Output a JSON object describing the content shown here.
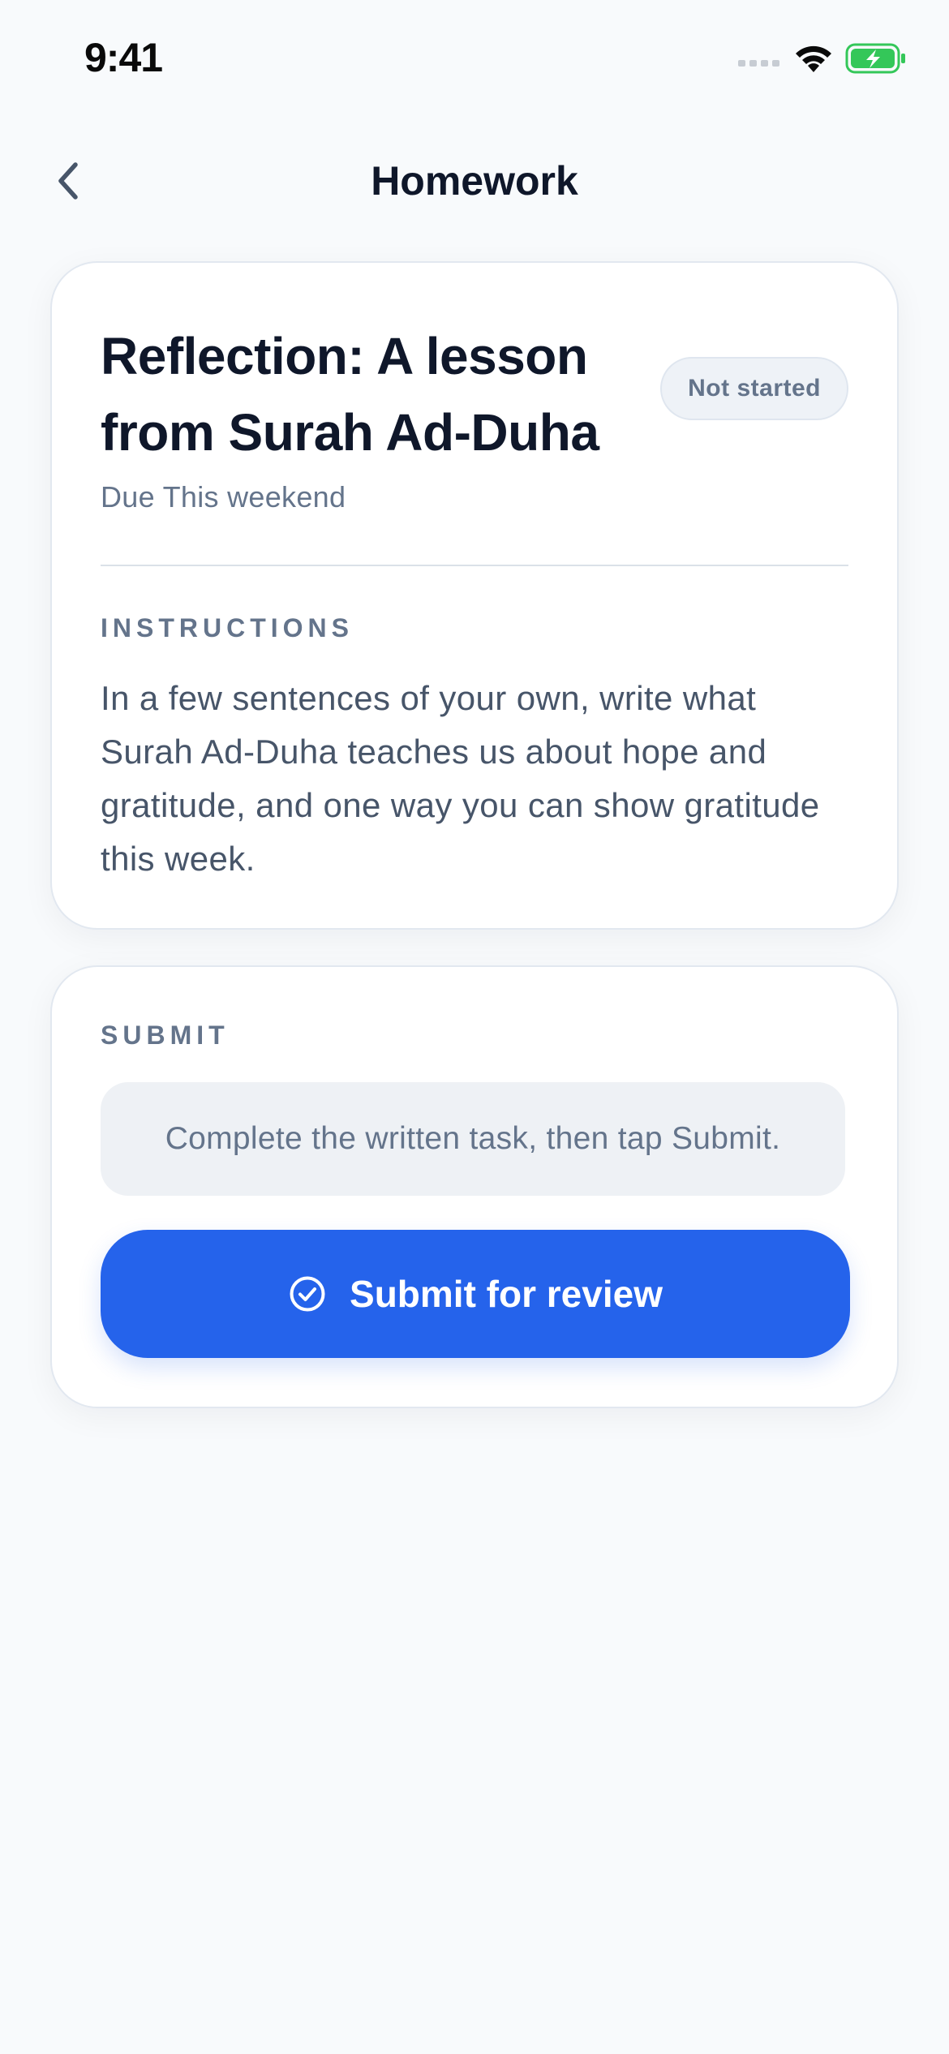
{
  "status_bar": {
    "time": "9:41"
  },
  "nav": {
    "title": "Homework"
  },
  "assignment": {
    "title": "Reflection: A lesson from Surah Ad-Duha",
    "status": "Not started",
    "due": "Due This weekend",
    "instructions_label": "INSTRUCTIONS",
    "instructions": "In a few sentences of your own, write what Surah Ad-Duha teaches us about hope and gratitude, and one way you can show gratitude this week."
  },
  "submit": {
    "section_label": "SUBMIT",
    "hint": "Complete the written task, then tap Submit.",
    "button_label": "Submit for review"
  },
  "colors": {
    "accent": "#2563eb",
    "background": "#f8fafc",
    "battery": "#34c759"
  },
  "icons": {
    "back": "chevron-left-icon",
    "signal": "cellular-signal-icon",
    "wifi": "wifi-icon",
    "battery": "battery-charging-icon",
    "submit": "check-circle-icon"
  }
}
